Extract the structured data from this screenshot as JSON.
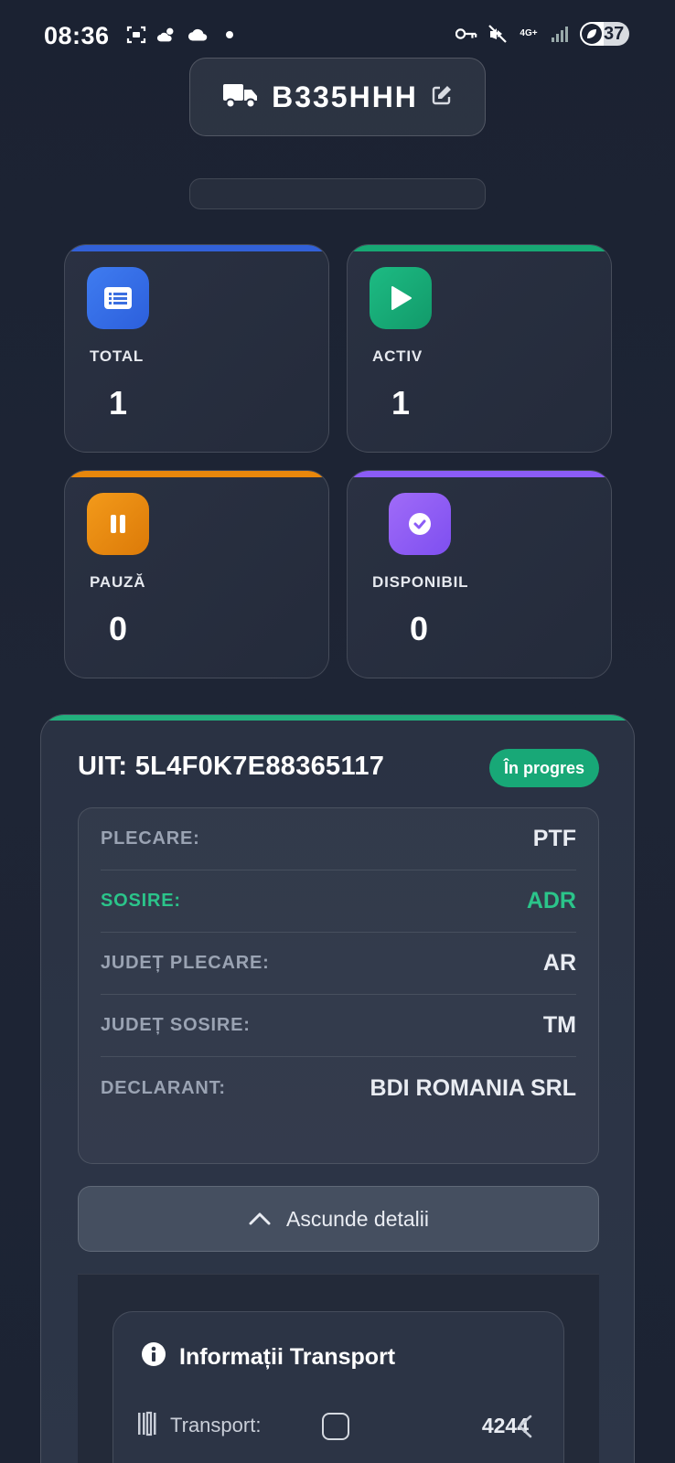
{
  "status_bar": {
    "time": "08:36",
    "network": "4G+",
    "battery": "37"
  },
  "header": {
    "plate": "B335HHH"
  },
  "stats": [
    {
      "label": "TOTAL",
      "value": "1",
      "color": "#3b6fe0"
    },
    {
      "label": "ACTIV",
      "value": "1",
      "color": "#17a874"
    },
    {
      "label": "PAUZĂ",
      "value": "0",
      "color": "#e8870c"
    },
    {
      "label": "DISPONIBIL",
      "value": "0",
      "color": "#8b5cf6"
    }
  ],
  "uit": {
    "title": "UIT: 5L4F0K7E88365117",
    "status": "În progres",
    "details": [
      {
        "key": "PLECARE:",
        "value": "PTF"
      },
      {
        "key": "SOSIRE:",
        "value": "ADR"
      },
      {
        "key": "JUDEȚ PLECARE:",
        "value": "AR"
      },
      {
        "key": "JUDEȚ SOSIRE:",
        "value": "TM"
      },
      {
        "key": "DECLARANT:",
        "value": "BDI ROMANIA SRL"
      }
    ],
    "toggle_label": "Ascunde detalii"
  },
  "transport": {
    "title": "Informații Transport",
    "row_label": "Transport:",
    "row_value": "4244"
  }
}
